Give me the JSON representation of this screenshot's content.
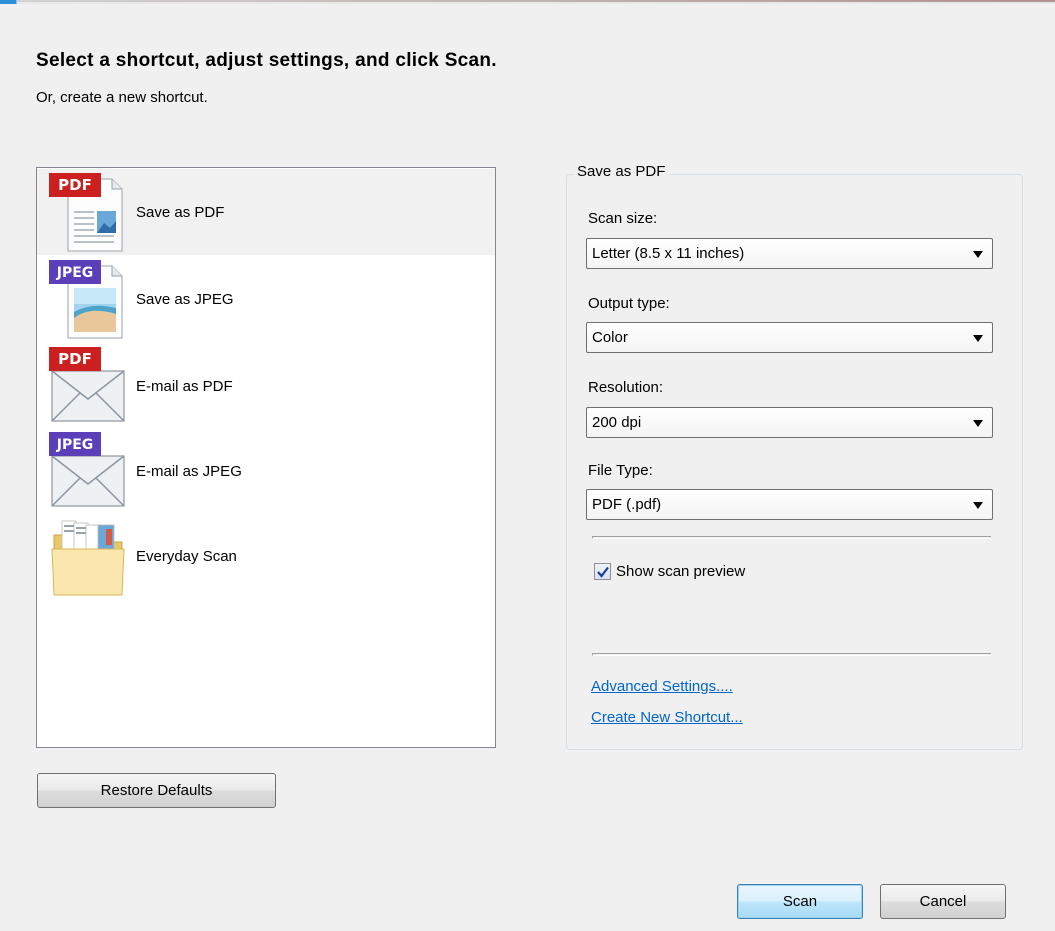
{
  "header": {
    "title": "Select a shortcut, adjust settings, and click Scan.",
    "subtitle": "Or, create a new shortcut."
  },
  "shortcuts": {
    "selected_index": 0,
    "items": [
      {
        "label": "Save as PDF",
        "icon": "pdf-document-icon",
        "badge": "PDF"
      },
      {
        "label": "Save as JPEG",
        "icon": "jpeg-image-icon",
        "badge": "JPEG"
      },
      {
        "label": "E-mail as PDF",
        "icon": "pdf-email-icon",
        "badge": "PDF"
      },
      {
        "label": "E-mail as JPEG",
        "icon": "jpeg-email-icon",
        "badge": "JPEG"
      },
      {
        "label": "Everyday Scan",
        "icon": "folder-icon",
        "badge": ""
      }
    ]
  },
  "settings": {
    "group_title": "Save as PDF",
    "scan_size": {
      "label": "Scan size:",
      "value": "Letter (8.5 x 11 inches)"
    },
    "output_type": {
      "label": "Output type:",
      "value": "Color"
    },
    "resolution": {
      "label": "Resolution:",
      "value": "200 dpi"
    },
    "file_type": {
      "label": "File Type:",
      "value": "PDF (.pdf)"
    },
    "show_preview": {
      "label": "Show scan preview",
      "checked": true
    },
    "advanced_link": "Advanced Settings....",
    "new_shortcut_link": "Create New Shortcut..."
  },
  "buttons": {
    "restore_defaults": "Restore Defaults",
    "scan": "Scan",
    "cancel": "Cancel"
  },
  "colors": {
    "pdf_badge": "#cc1f1f",
    "jpeg_badge": "#5a3fb8",
    "link": "#0066cc",
    "selected_row": "#f1f1f1"
  }
}
